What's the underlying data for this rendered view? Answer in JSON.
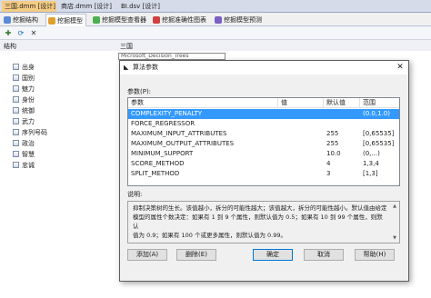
{
  "document_tabs": [
    {
      "label": "三国.dmm [设计]",
      "active": true
    },
    {
      "label": "商店.dmm [设计]",
      "active": false
    },
    {
      "label": "BI.dsv [设计]",
      "active": false
    }
  ],
  "designer_tabs": [
    {
      "label": "挖掘结构",
      "icon": "structure-icon"
    },
    {
      "label": "挖掘模型",
      "icon": "model-icon"
    },
    {
      "label": "挖掘模型查看器",
      "icon": "viewer-icon"
    },
    {
      "label": "挖掘准确性图表",
      "icon": "chart-icon"
    },
    {
      "label": "挖掘模型预测",
      "icon": "prediction-icon"
    }
  ],
  "toolbar_icons": [
    "add-model-icon",
    "process-icon",
    "delete-icon"
  ],
  "columns": {
    "structure": "结构",
    "model": "三国"
  },
  "tree_items": [
    "出身",
    "国别",
    "魅力",
    "身份",
    "统御",
    "武力",
    "序列号码",
    "政治",
    "智慧",
    "忠诚"
  ],
  "background_cell": "Microsoft_Decision_Trees",
  "dialog": {
    "title": "算法参数",
    "params_label": "参数(P):",
    "headers": {
      "param": "参数",
      "value": "值",
      "default": "默认值",
      "range": "范围"
    },
    "rows": [
      {
        "param": "COMPLEXITY_PENALTY",
        "value": "",
        "default": "",
        "range": "(0.0,1.0)",
        "selected": true
      },
      {
        "param": "FORCE_REGRESSOR",
        "value": "",
        "default": "",
        "range": "",
        "selected": false
      },
      {
        "param": "MAXIMUM_INPUT_ATTRIBUTES",
        "value": "",
        "default": "255",
        "range": "[0,65535]",
        "selected": false
      },
      {
        "param": "MAXIMUM_OUTPUT_ATTRIBUTES",
        "value": "",
        "default": "255",
        "range": "[0,65535]",
        "selected": false
      },
      {
        "param": "MINIMUM_SUPPORT",
        "value": "",
        "default": "10.0",
        "range": "(0,...)",
        "selected": false
      },
      {
        "param": "SCORE_METHOD",
        "value": "",
        "default": "4",
        "range": "1,3,4",
        "selected": false
      },
      {
        "param": "SPLIT_METHOD",
        "value": "",
        "default": "3",
        "range": "[1,3]",
        "selected": false
      }
    ],
    "description_label": "说明:",
    "description_lines": [
      "抑制决策树的生长。该值越小，拆分的可能性越大；该值越大，拆分的可能性越小。默认值由给定",
      "模型的属性个数决定：如果有 1 到 9 个属性，则默认值为 0.5；如果有 10 到 99 个属性，则默认",
      "值为 0.9；如果有 100 个或更多属性，则默认值为 0.99。"
    ],
    "buttons": {
      "add": "添加(A)",
      "delete": "删除(E)",
      "ok": "确定",
      "cancel": "取消",
      "help": "帮助(H)"
    }
  },
  "colors": {
    "selection": "#3399ff",
    "active_doc_tab": "#f5cc84"
  }
}
